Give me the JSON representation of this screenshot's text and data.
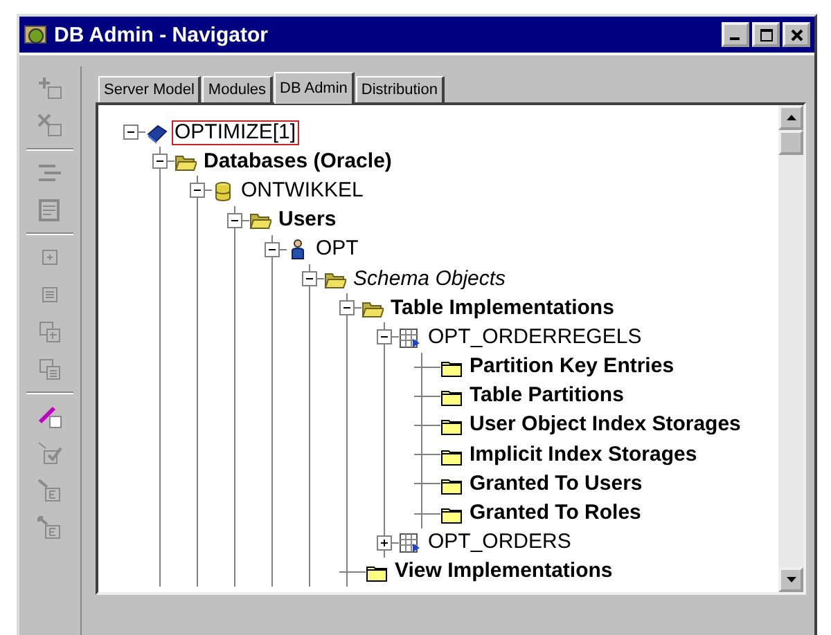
{
  "window": {
    "title": "DB Admin - Navigator"
  },
  "toolbar": [
    {
      "kind": "add",
      "disabled": true
    },
    {
      "kind": "remove",
      "disabled": true
    },
    {
      "kind": "sep"
    },
    {
      "kind": "shuffle",
      "disabled": true
    },
    {
      "kind": "sheet",
      "disabled": true
    },
    {
      "kind": "sep"
    },
    {
      "kind": "box-add",
      "disabled": true
    },
    {
      "kind": "box-list",
      "disabled": true
    },
    {
      "kind": "boxes-add",
      "disabled": true
    },
    {
      "kind": "boxes-list",
      "disabled": true
    },
    {
      "kind": "sep"
    },
    {
      "kind": "pencil",
      "disabled": false
    },
    {
      "kind": "check",
      "disabled": true
    },
    {
      "kind": "arrow-box",
      "disabled": true
    },
    {
      "kind": "arrow-box-up",
      "disabled": true
    }
  ],
  "tabs": [
    {
      "label": "Server Model",
      "selected": false
    },
    {
      "label": "Modules",
      "selected": false
    },
    {
      "label": "DB Admin",
      "selected": true
    },
    {
      "label": "Distribution",
      "selected": false
    }
  ],
  "tree": [
    {
      "label": "OPTIMIZE[1]",
      "kind": "book",
      "bold": false,
      "italic": false,
      "selected": true,
      "expanded": true,
      "children": [
        {
          "label": "Databases (Oracle)",
          "kind": "folder-open",
          "bold": true,
          "italic": false,
          "selected": false,
          "expanded": true,
          "children": [
            {
              "label": "ONTWIKKEL",
              "kind": "database",
              "bold": false,
              "italic": false,
              "selected": false,
              "expanded": true,
              "children": [
                {
                  "label": "Users",
                  "kind": "folder-open",
                  "bold": true,
                  "italic": false,
                  "selected": false,
                  "expanded": true,
                  "children": [
                    {
                      "label": "OPT",
                      "kind": "user",
                      "bold": false,
                      "italic": false,
                      "selected": false,
                      "expanded": true,
                      "children": [
                        {
                          "label": "Schema Objects",
                          "kind": "folder-open",
                          "bold": false,
                          "italic": true,
                          "selected": false,
                          "expanded": true,
                          "children": [
                            {
                              "label": "Table Implementations",
                              "kind": "folder-open",
                              "bold": true,
                              "italic": false,
                              "selected": false,
                              "expanded": true,
                              "children": [
                                {
                                  "label": "OPT_ORDERREGELS",
                                  "kind": "table",
                                  "bold": false,
                                  "italic": false,
                                  "selected": false,
                                  "expanded": true,
                                  "children": [
                                    {
                                      "label": "Partition Key Entries",
                                      "kind": "folder",
                                      "bold": true,
                                      "italic": false,
                                      "selected": false
                                    },
                                    {
                                      "label": "Table Partitions",
                                      "kind": "folder",
                                      "bold": true,
                                      "italic": false,
                                      "selected": false
                                    },
                                    {
                                      "label": "User Object Index Storages",
                                      "kind": "folder",
                                      "bold": true,
                                      "italic": false,
                                      "selected": false
                                    },
                                    {
                                      "label": "Implicit Index Storages",
                                      "kind": "folder",
                                      "bold": true,
                                      "italic": false,
                                      "selected": false
                                    },
                                    {
                                      "label": "Granted To Users",
                                      "kind": "folder",
                                      "bold": true,
                                      "italic": false,
                                      "selected": false
                                    },
                                    {
                                      "label": "Granted To Roles",
                                      "kind": "folder",
                                      "bold": true,
                                      "italic": false,
                                      "selected": false
                                    }
                                  ]
                                },
                                {
                                  "label": "OPT_ORDERS",
                                  "kind": "table",
                                  "bold": false,
                                  "italic": false,
                                  "selected": false,
                                  "expanded": false
                                }
                              ]
                            },
                            {
                              "label": "View Implementations",
                              "kind": "folder",
                              "bold": true,
                              "italic": false,
                              "selected": false
                            }
                          ]
                        }
                      ]
                    }
                  ]
                }
              ]
            }
          ]
        }
      ]
    }
  ]
}
